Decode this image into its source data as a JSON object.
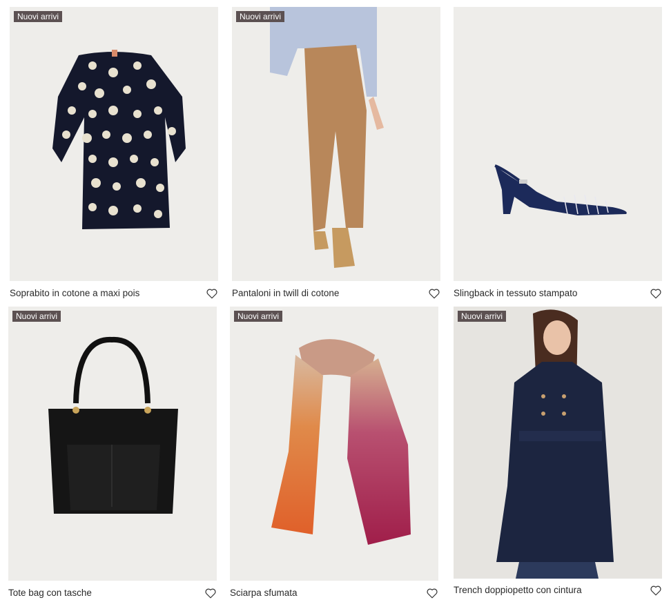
{
  "products": [
    {
      "badge": "Nuovi arrivi",
      "name": "Soprabito in cotone a maxi pois",
      "icon": "heart-outline-icon"
    },
    {
      "badge": "Nuovi arrivi",
      "name": "Pantaloni in twill di cotone",
      "icon": "heart-outline-icon"
    },
    {
      "badge": "",
      "name": "Slingback in tessuto stampato",
      "icon": "heart-outline-icon"
    },
    {
      "badge": "Nuovi arrivi",
      "name": "Tote bag con tasche",
      "icon": "heart-outline-icon"
    },
    {
      "badge": "Nuovi arrivi",
      "name": "Sciarpa sfumata",
      "icon": "heart-outline-icon"
    },
    {
      "badge": "Nuovi arrivi",
      "name": "Trench doppiopetto con cintura",
      "icon": "heart-outline-icon"
    }
  ],
  "colors": {
    "badge_bg": "#5c5152",
    "image_bg": "#eeedea",
    "text": "#2a2a2a"
  }
}
